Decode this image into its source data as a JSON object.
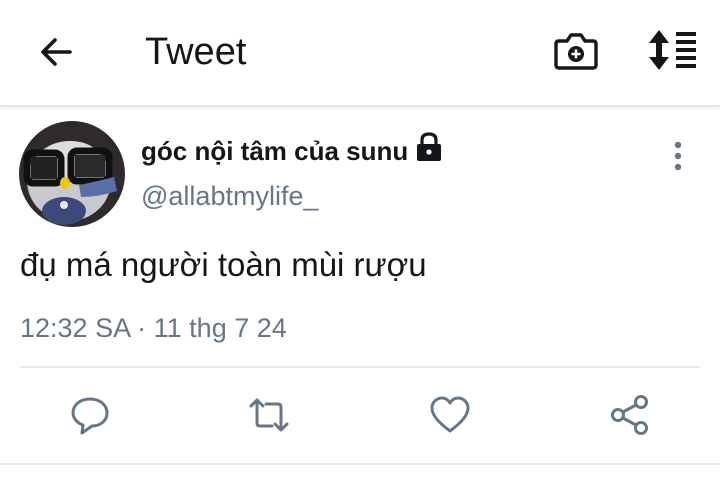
{
  "header": {
    "title": "Tweet"
  },
  "tweet": {
    "display_name": "góc nội tâm của sunu",
    "handle": "@allabtmylife_",
    "protected": true,
    "text": "đụ má người toàn mùi rượu",
    "time": "12:32 SA",
    "separator": "·",
    "date": "11 thg 7 24"
  },
  "icons": {
    "back": "arrow-left-icon",
    "camera": "camera-plus-icon",
    "sort": "sort-icon",
    "lock": "lock-icon",
    "more": "more-vertical-icon",
    "reply": "reply-icon",
    "retweet": "retweet-icon",
    "like": "heart-icon",
    "share": "share-icon"
  },
  "colors": {
    "text": "#14171a",
    "secondary": "#657786",
    "divider": "#e8ebed"
  }
}
